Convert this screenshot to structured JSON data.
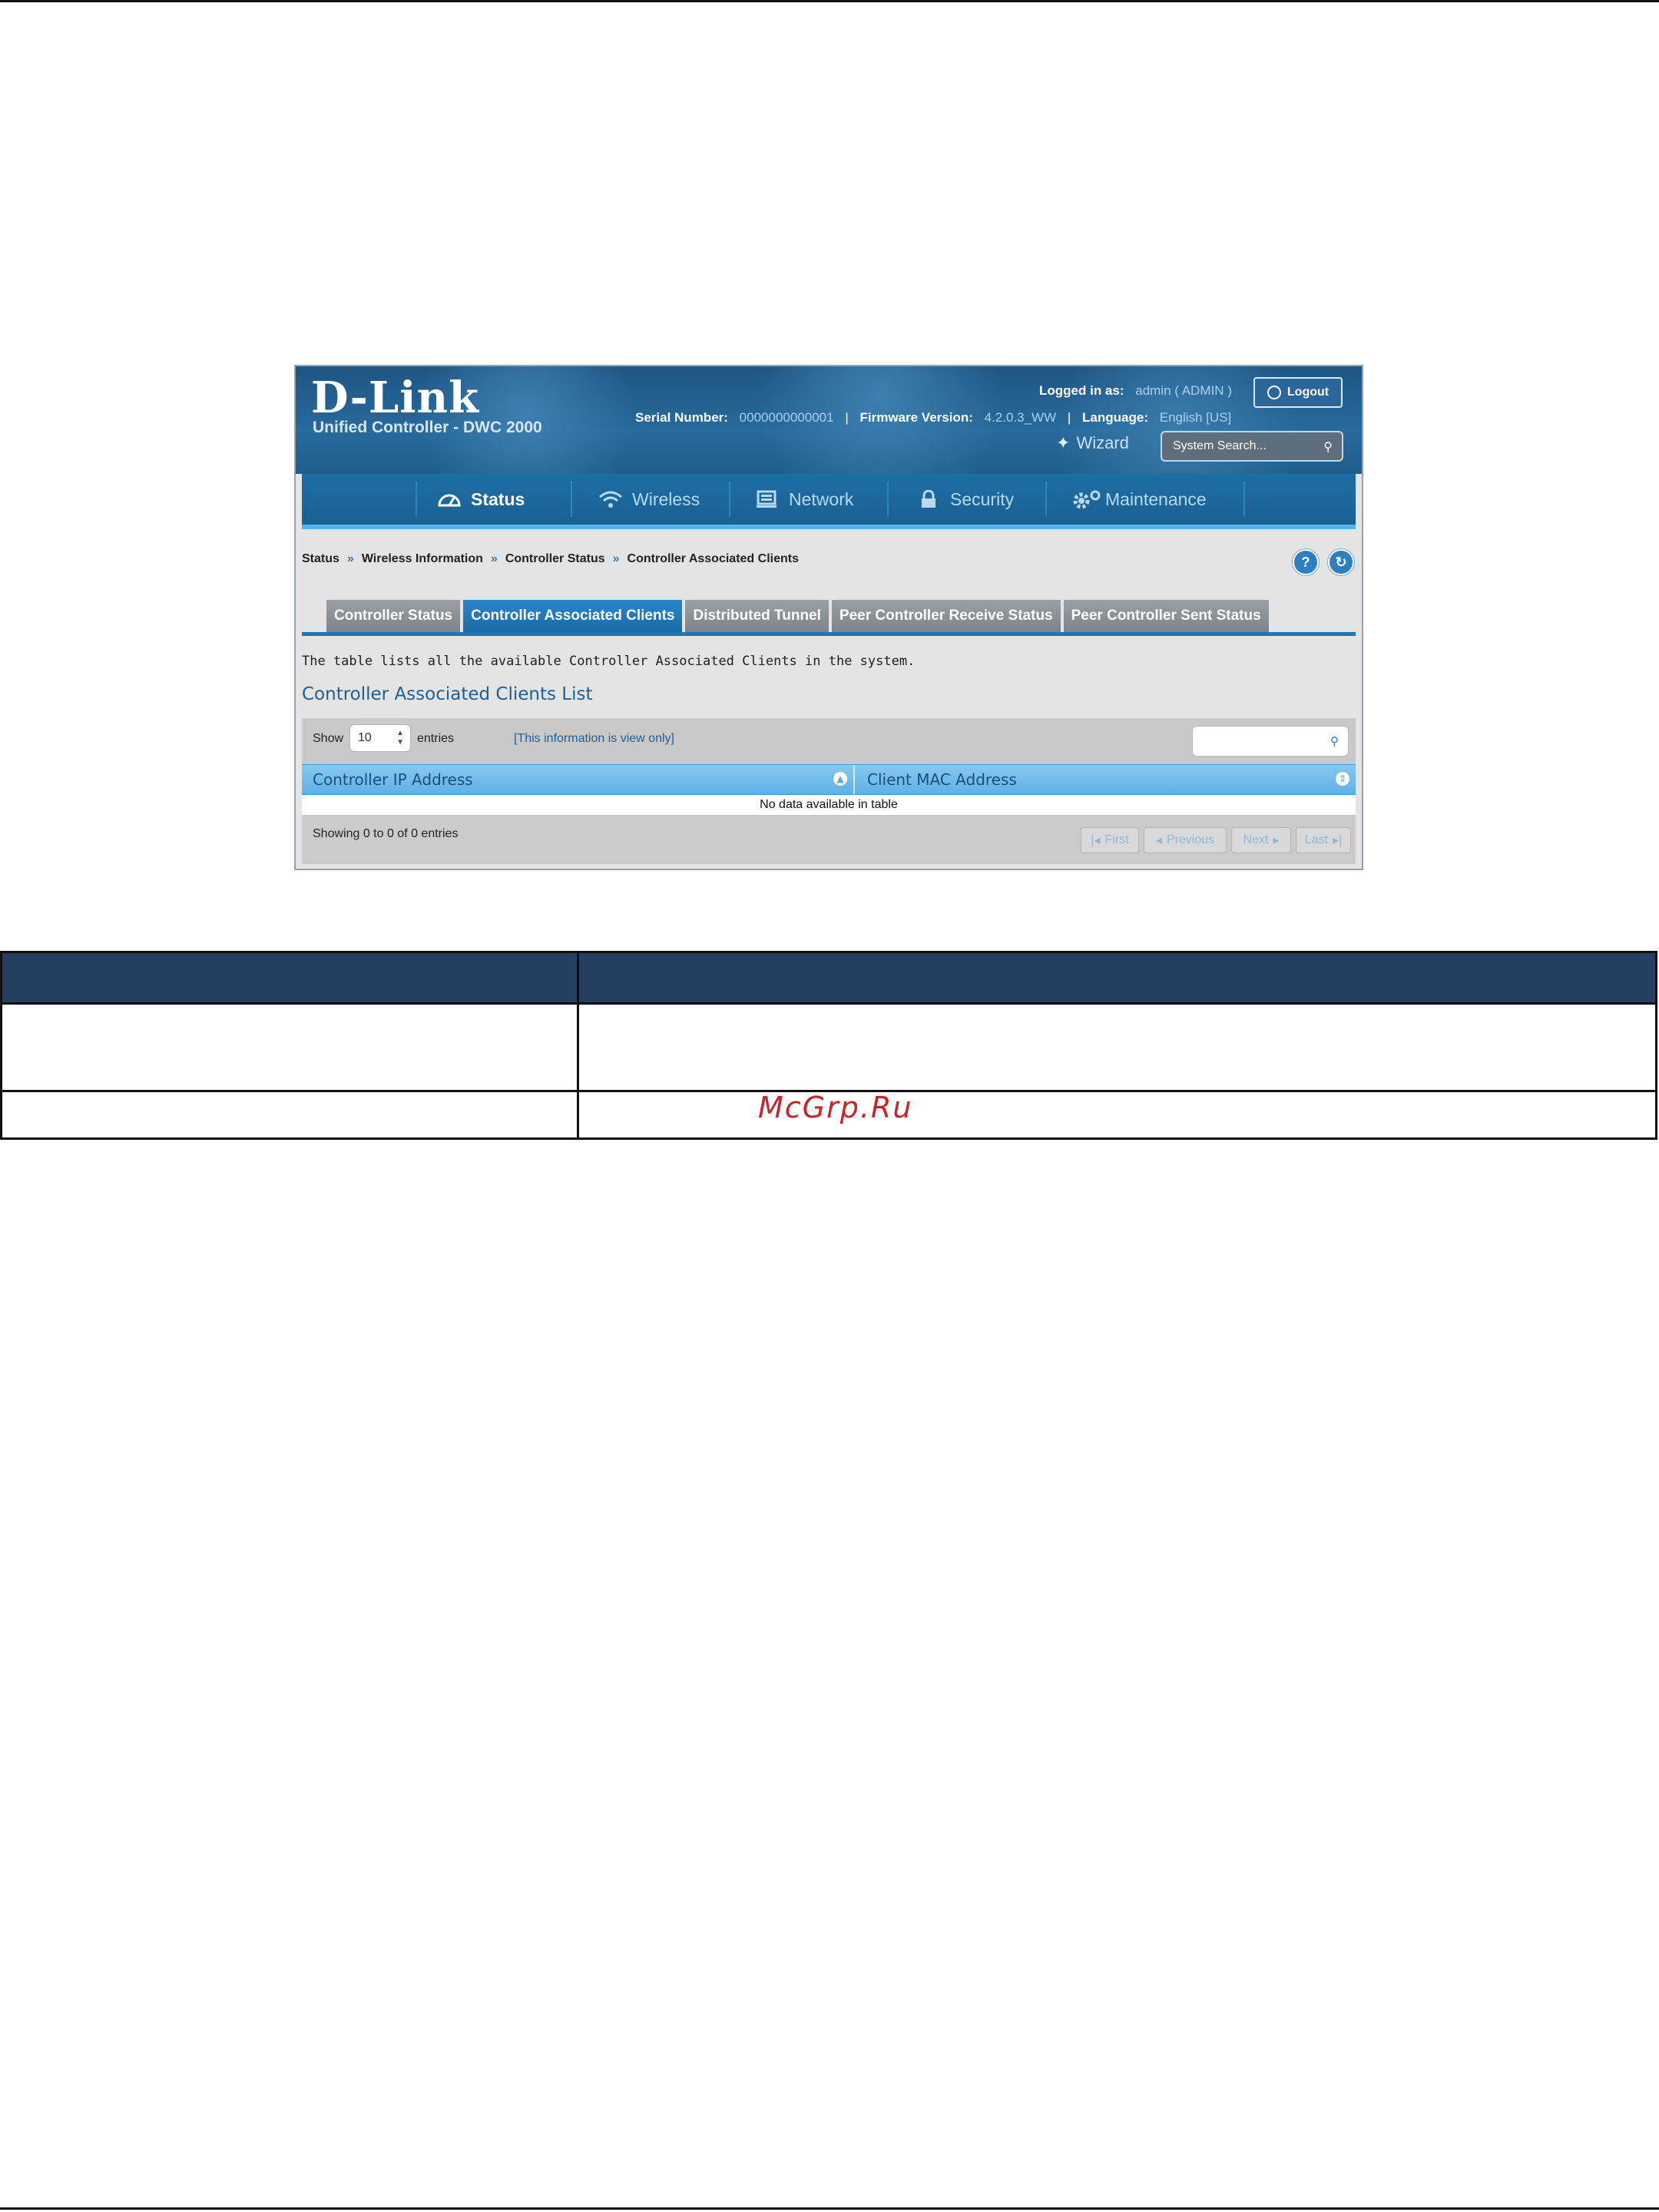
{
  "header": {
    "logo": "D-Link",
    "subtitle": "Unified Controller - DWC 2000",
    "logged_in_label": "Logged in as:",
    "logged_in_value": "admin ( ADMIN )",
    "logout_label": "Logout",
    "serial_label": "Serial Number:",
    "serial_value": "0000000000001",
    "firmware_label": "Firmware Version:",
    "firmware_value": "4.2.0.3_WW",
    "language_label": "Language:",
    "language_value": "English [US]",
    "wizard_label": "Wizard",
    "system_search_placeholder": "System Search..."
  },
  "nav": {
    "items": [
      {
        "label": "Status",
        "icon": "gauge-icon",
        "active": true
      },
      {
        "label": "Wireless",
        "icon": "wifi-icon",
        "active": false
      },
      {
        "label": "Network",
        "icon": "network-icon",
        "active": false
      },
      {
        "label": "Security",
        "icon": "lock-icon",
        "active": false
      },
      {
        "label": "Maintenance",
        "icon": "gears-icon",
        "active": false
      }
    ]
  },
  "breadcrumb": [
    "Status",
    "Wireless Information",
    "Controller Status",
    "Controller Associated Clients"
  ],
  "breadcrumb_separator": "»",
  "help_buttons": {
    "help": "?",
    "refresh": "↻"
  },
  "tabs": [
    {
      "label": "Controller Status",
      "active": false
    },
    {
      "label": "Controller Associated Clients",
      "active": true
    },
    {
      "label": "Distributed Tunnel",
      "active": false
    },
    {
      "label": "Peer Controller Receive Status",
      "active": false
    },
    {
      "label": "Peer Controller Sent Status",
      "active": false
    }
  ],
  "main": {
    "description": "The table lists all the available Controller Associated Clients in the system.",
    "list_title": "Controller Associated Clients List",
    "show_label": "Show",
    "entries_value": "10",
    "entries_label": "entries",
    "view_only_note": "[This information is view only]",
    "columns": [
      "Controller IP Address",
      "Client MAC Address"
    ],
    "empty_message": "No data available in table",
    "showing_text": "Showing 0 to 0 of 0 entries",
    "pagination": [
      "First",
      "Previous",
      "Next",
      "Last"
    ]
  },
  "page_table": {
    "header": [
      "",
      ""
    ],
    "rows": [
      [
        "",
        ""
      ],
      [
        "",
        ""
      ]
    ]
  },
  "watermark": "McGrp.Ru",
  "colors": {
    "header_blue": "#1e5684",
    "active_tab": "#1a6aa6",
    "table_header": "#243f60",
    "watermark": "#c8242c"
  }
}
